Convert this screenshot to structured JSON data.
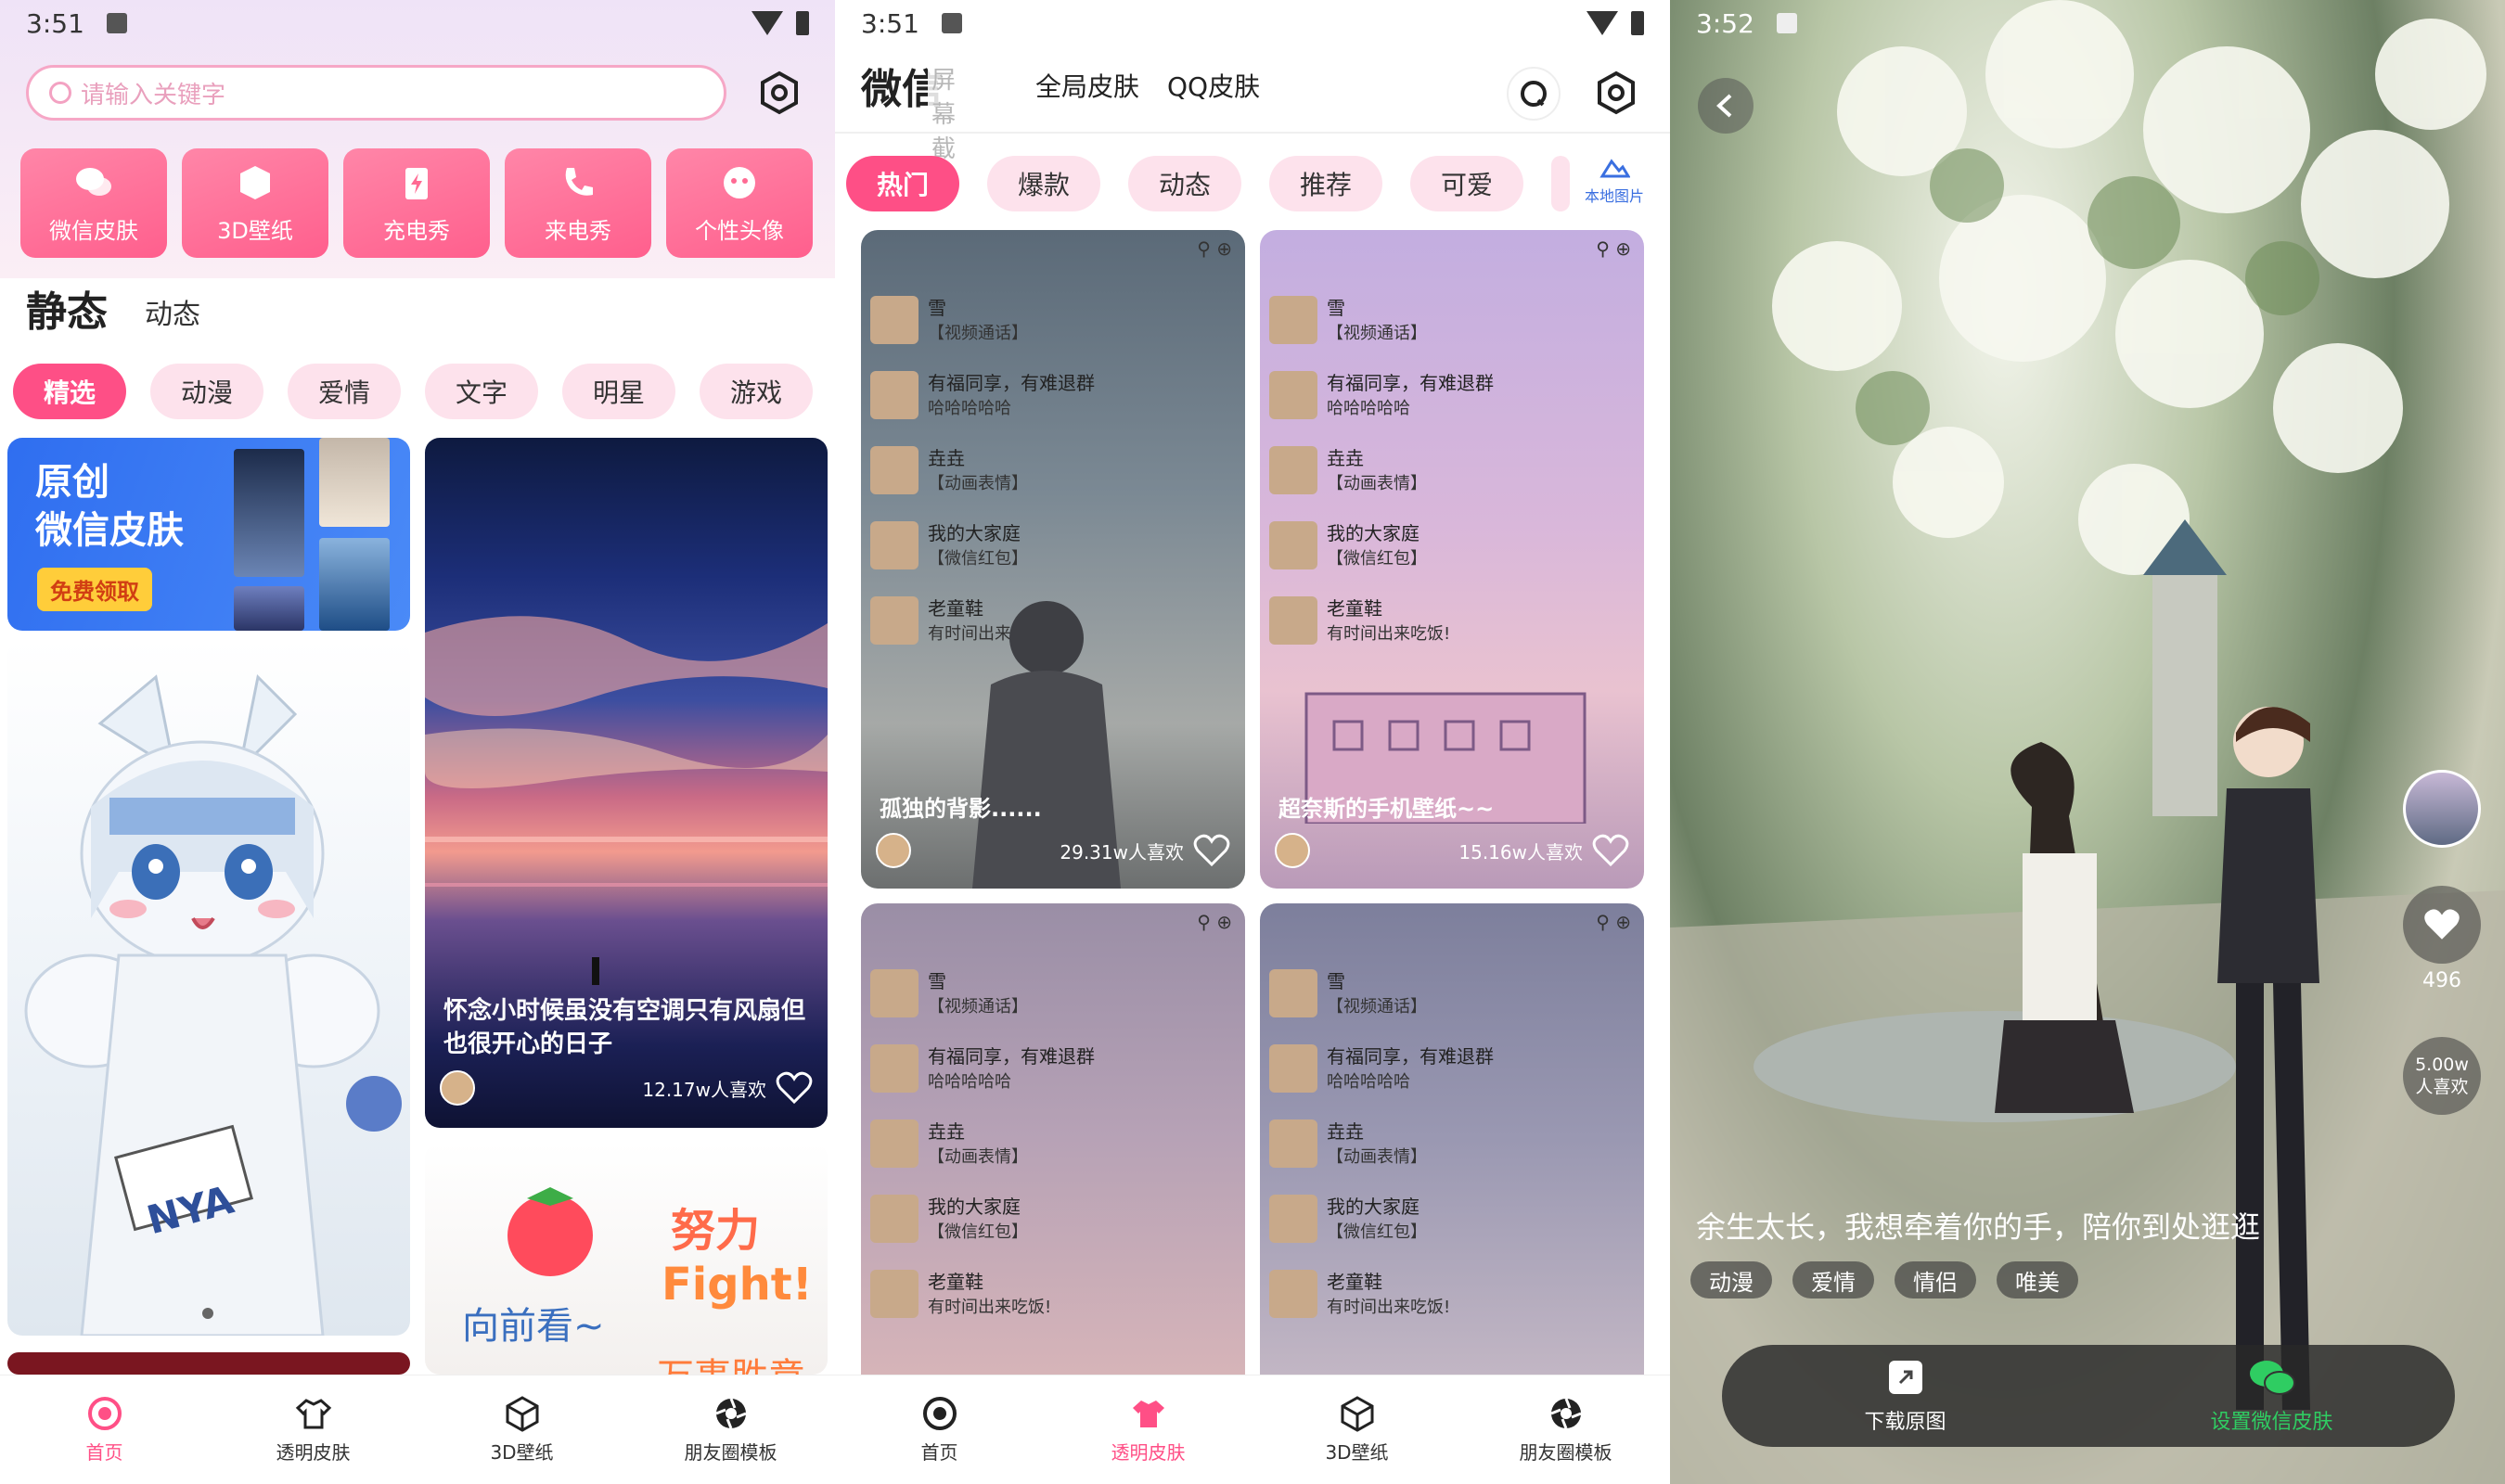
{
  "status": {
    "time1": "3:51",
    "time2": "3:51",
    "time3": "3:52"
  },
  "p1": {
    "search_placeholder": "请输入关键字",
    "categories": [
      {
        "label": "微信皮肤"
      },
      {
        "label": "3D壁纸"
      },
      {
        "label": "充电秀"
      },
      {
        "label": "来电秀"
      },
      {
        "label": "个性头像"
      }
    ],
    "tab_static": "静态",
    "tab_dynamic": "动态",
    "pills": [
      "精选",
      "动漫",
      "爱情",
      "文字",
      "明星",
      "游戏"
    ],
    "banner": {
      "line1": "原创",
      "line2": "微信皮肤",
      "button": "免费领取"
    },
    "anime_sign": "NYA",
    "card2": {
      "caption": "怀念小时候虽没有空调只有风扇但也很开心的日子",
      "likes": "12.17w人喜欢"
    },
    "card3": {
      "t1": "努力",
      "t2": "Fight!",
      "t3": "向前看~",
      "t4": "万事胜意"
    },
    "nav": [
      "首页",
      "透明皮肤",
      "3D壁纸",
      "朋友圈模板"
    ]
  },
  "p2": {
    "title": "微信",
    "overlay": "屏幕截",
    "tabs": [
      "全局皮肤",
      "QQ皮肤"
    ],
    "pills": [
      "热门",
      "爆款",
      "动态",
      "推荐",
      "可爱"
    ],
    "local": "本地图片",
    "chats": [
      {
        "name": "雪",
        "msg": "【视频通话】"
      },
      {
        "name": "有福同享，有难退群",
        "msg": "哈哈哈哈哈"
      },
      {
        "name": "垚垚",
        "msg": "【动画表情】"
      },
      {
        "name": "我的大家庭",
        "msg": "【微信红包】"
      },
      {
        "name": "老童鞋",
        "msg": "有时间出来吃饭!"
      }
    ],
    "card1": {
      "caption": "孤独的背影......",
      "likes": "29.31w人喜欢"
    },
    "card2": {
      "caption": "超奈斯的手机壁纸~~",
      "likes": "15.16w人喜欢"
    },
    "nav": [
      "首页",
      "透明皮肤",
      "3D壁纸",
      "朋友圈模板"
    ]
  },
  "p3": {
    "likes_count": "496",
    "fans_line1": "5.00w",
    "fans_line2": "人喜欢",
    "caption": "余生太长，我想牵着你的手，陪你到处逛逛",
    "tags": [
      "动漫",
      "爱情",
      "情侣",
      "唯美"
    ],
    "download": "下载原图",
    "set_skin": "设置微信皮肤"
  },
  "colors": {
    "accent": "#fe4f86",
    "pill_bg": "#fde2ec",
    "wechat_green": "#2fcd62"
  }
}
